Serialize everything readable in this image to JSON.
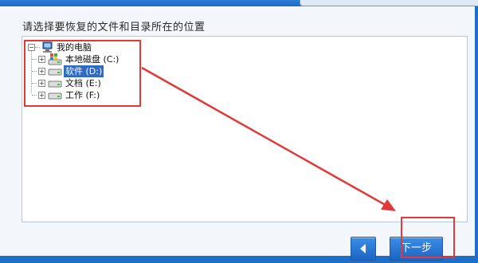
{
  "dialog": {
    "instruction": "请选择要恢复的文件和目录所在的位置",
    "next_label": "下一步"
  },
  "tree": {
    "root": "我的电脑",
    "drives": [
      {
        "label": "本地磁盘 (C:)",
        "icon": "windows-drive-icon",
        "selected": false
      },
      {
        "label": "软件 (D:)",
        "icon": "drive-icon",
        "selected": true
      },
      {
        "label": "文档 (E:)",
        "icon": "drive-icon",
        "selected": false
      },
      {
        "label": "工作 (F:)",
        "icon": "drive-icon",
        "selected": false
      }
    ]
  },
  "colors": {
    "accent": "#1f6fc9",
    "selection": "#316ac5",
    "annotation": "#e33838"
  }
}
